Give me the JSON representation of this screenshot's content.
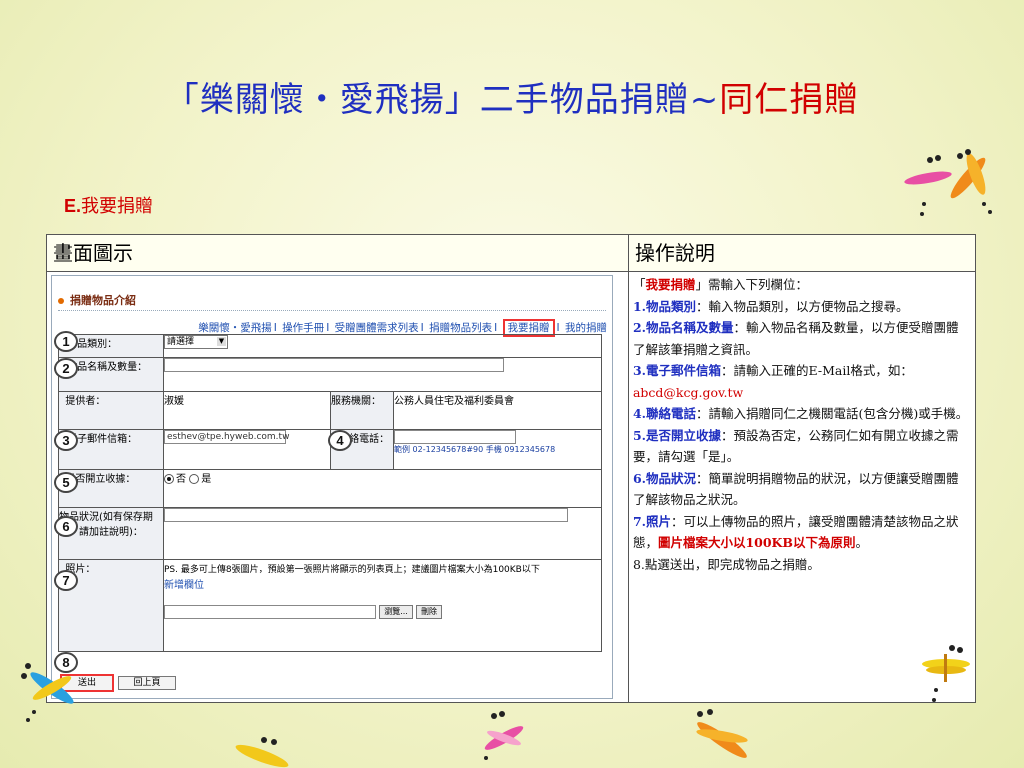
{
  "slide": {
    "title_part1": "「樂關懷・愛飛揚」二手物品捐贈~",
    "title_part2": "同仁捐贈",
    "section_letter": "E.",
    "section_label": "我要捐贈"
  },
  "table": {
    "col1_header": "畫面圖示",
    "col2_header": "操作說明"
  },
  "screenshot": {
    "page_title": "捐贈物品介紹",
    "nav": [
      "樂關懷・愛飛揚",
      "操作手冊",
      "受贈團體需求列表",
      "捐贈物品列表",
      "我要捐贈",
      "我的捐贈"
    ],
    "fields": {
      "category_label": "物品類別：",
      "category_value": "請選擇",
      "name_label": "物品名稱及數量：",
      "provider_label": "提供者：",
      "provider_value": "淑媛",
      "org_label": "服務機關：",
      "org_value": "公務人員住宅及福利委員會",
      "email_label": "電子郵件信箱：",
      "email_value": "esthev@tpe.hyweb.com.tw",
      "phone_label": "聯絡電話：",
      "phone_hint": "範例 02-12345678#90 手機 0912345678",
      "receipt_label": "是否開立收據：",
      "receipt_no": "否",
      "receipt_yes": "是",
      "condition_label": "物品狀況(如有保存期限，請加註說明)：",
      "photo_label": "照片：",
      "photo_note": "PS. 最多可上傳8張圖片，預設第一張照片將顯示的列表頁上；建議圖片檔案大小為100KB以下",
      "add_field": "新增欄位",
      "browse": "瀏覽...",
      "delete": "刪除"
    },
    "badges": [
      "1",
      "2",
      "3",
      "4",
      "5",
      "6",
      "7",
      "8"
    ],
    "submit_button": "送出",
    "back_button": "回上頁"
  },
  "instructions": {
    "intro_pre": "「",
    "intro_kw": "我要捐贈",
    "intro_post": "」需輸入下列欄位：",
    "items": [
      {
        "num": "1.",
        "kw": "物品類別",
        "text": "：輸入物品類別，以方便物品之搜尋。"
      },
      {
        "num": "2.",
        "kw": "物品名稱及數量",
        "text": "：輸入物品名稱及數量，以方便受贈團體了解該筆捐贈之資訊。"
      },
      {
        "num": "3.",
        "kw": "電子郵件信箱",
        "text": "：請輸入正確的E-Mail格式，如：",
        "extra": "abcd@kcg.gov.tw"
      },
      {
        "num": "4.",
        "kw": "聯絡電話",
        "text": "：請輸入捐贈同仁之機關電話(包含分機)或手機。"
      },
      {
        "num": "5.",
        "kw": "是否開立收據",
        "text": "：預設為否定，公務同仁如有開立收據之需要，請勾選「是」。"
      },
      {
        "num": "6.",
        "kw": "物品狀況",
        "text": "：簡單說明捐贈物品的狀況，以方便讓受贈團體了解該物品之狀況。"
      },
      {
        "num": "7.",
        "kw": "照片",
        "text": "：可以上傳物品的照片，讓受贈團體清楚該物品之狀態，",
        "red": "圖片檔案大小以100KB以下為原則",
        "tail": "。"
      },
      {
        "num": "8.",
        "kw": "",
        "text": "點選送出，即完成物品之捐贈。"
      }
    ]
  },
  "colors": {
    "title_blue": "#1f2fc0",
    "accent_red": "#d10000",
    "background": "#f2f3c9"
  }
}
